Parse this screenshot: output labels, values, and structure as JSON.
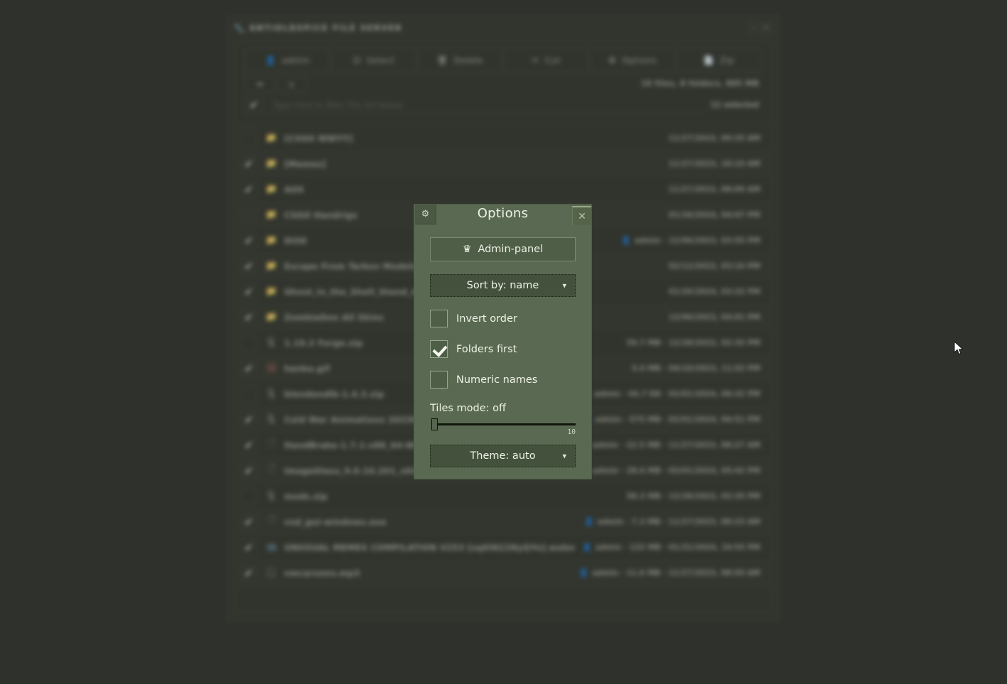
{
  "window": {
    "title": "ANTIOLDSPICE FILE SERVER",
    "wrench_icon": "wrench-icon",
    "minimize_label": "–",
    "close_label": "✕",
    "stats": "10 files, 8 folders, 885 MB",
    "selected_count": "12 selected"
  },
  "toolbar": {
    "buttons": [
      {
        "label": "admin",
        "icon": "user-icon",
        "glyph": "●"
      },
      {
        "label": "Select",
        "icon": "select-icon",
        "glyph": "☑"
      },
      {
        "label": "Delete",
        "icon": "trash-icon",
        "glyph": "■"
      },
      {
        "label": "Cut",
        "icon": "scissors-icon",
        "glyph": "✂"
      },
      {
        "label": "Options",
        "icon": "gear-icon",
        "glyph": "⚙"
      },
      {
        "label": "Zip",
        "icon": "zip-icon",
        "glyph": "▤"
      }
    ],
    "nav": [
      {
        "label": "⬅",
        "icon": "back-arrow-icon"
      },
      {
        "label": "⌂",
        "icon": "home-icon"
      }
    ]
  },
  "filter": {
    "placeholder": "Type here to filter the list below",
    "select_all_glyph": "✔"
  },
  "files": [
    {
      "name": "[CSGO WWYY]",
      "type": "folder",
      "icon": "folder-icon",
      "checked": false,
      "owner": "",
      "size": "",
      "date": "11/27/2023, 09:35 AM"
    },
    {
      "name": "[Memes]",
      "type": "folder",
      "icon": "folder-icon",
      "checked": true,
      "owner": "",
      "size": "",
      "date": "11/27/2023, 10:19 AM"
    },
    {
      "name": "AOS",
      "type": "folder",
      "icon": "folder-icon",
      "checked": true,
      "owner": "",
      "size": "",
      "date": "11/27/2023, 08:09 AM"
    },
    {
      "name": "CSGO Handrigs",
      "type": "folder",
      "icon": "folder-icon",
      "checked": false,
      "owner": "",
      "size": "",
      "date": "01/26/2024, 04:07 PM"
    },
    {
      "name": "DISK",
      "type": "folder",
      "icon": "folder-icon",
      "checked": true,
      "owner": "admin",
      "size": "",
      "date": "12/06/2023, 03:55 PM"
    },
    {
      "name": "Escape From Tarkov Models",
      "type": "folder",
      "icon": "folder-icon",
      "checked": true,
      "owner": "",
      "size": "",
      "date": "02/12/2022, 03:16 PM"
    },
    {
      "name": "Ghost_in_the_Shell_Stand_Alone",
      "type": "folder",
      "icon": "folder-icon",
      "checked": true,
      "owner": "",
      "size": "",
      "date": "01/26/2024, 03:32 PM"
    },
    {
      "name": "ZombieDen All Skins",
      "type": "folder",
      "icon": "folder-icon",
      "checked": true,
      "owner": "",
      "size": "",
      "date": "12/06/2023, 04:01 PM"
    },
    {
      "name": "1.19.2 Forge.zip",
      "type": "archive",
      "icon": "archive-icon",
      "checked": false,
      "owner": "",
      "size": "59.7 MB",
      "date": "12/28/2022, 02:35 PM"
    },
    {
      "name": "hanka.gif",
      "type": "image",
      "icon": "image-icon",
      "checked": true,
      "owner": "",
      "size": "5.9 MB",
      "date": "04/16/2023, 11:52 PM"
    },
    {
      "name": "blendendlb-1.4.3.zip",
      "type": "archive",
      "icon": "archive-icon",
      "checked": false,
      "owner": "admin",
      "size": "44.7 KB",
      "date": "02/01/2024, 06:32 PM"
    },
    {
      "name": "Cold War Animations 2023M",
      "type": "archive",
      "icon": "archive-icon",
      "checked": true,
      "owner": "admin",
      "size": "575 MB",
      "date": "02/01/2024, 06:51 PM"
    },
    {
      "name": "HandBrake-1.7.1-x86_64-Win",
      "type": "file",
      "icon": "file-icon",
      "checked": true,
      "owner": "admin",
      "size": "22.5 MB",
      "date": "11/27/2023, 08:27 AM"
    },
    {
      "name": "ImageGlass_9.0.10.201_x64.msi",
      "type": "file",
      "icon": "file-icon",
      "checked": true,
      "owner": "admin",
      "size": "28.6 MB",
      "date": "02/01/2024, 05:42 PM"
    },
    {
      "name": "mods.zip",
      "type": "archive",
      "icon": "archive-icon",
      "checked": false,
      "owner": "",
      "size": "58.3 MB",
      "date": "12/28/2022, 02:35 PM"
    },
    {
      "name": "vsd_gui-windows.exe",
      "type": "file",
      "icon": "file-icon",
      "checked": true,
      "owner": "admin",
      "size": "7.3 MB",
      "date": "11/27/2023, 08:23 AM"
    },
    {
      "name": "UNUSUAL MEMES COMPILATION V253 [sq0iN22NyQYo].webm",
      "type": "video",
      "icon": "video-icon",
      "checked": true,
      "owner": "admin",
      "size": "122 MB",
      "date": "01/31/2024, 10:55 PM"
    },
    {
      "name": "vmcarsons.mp3",
      "type": "audio",
      "icon": "headphone-icon",
      "checked": true,
      "owner": "admin",
      "size": "11.6 MB",
      "date": "11/27/2023, 08:59 AM"
    }
  ],
  "options_dialog": {
    "title": "Options",
    "gear_icon": "gear-icon",
    "close_label": "✕",
    "admin_panel": {
      "label": "Admin-panel",
      "icon": "crown-icon"
    },
    "sort_select": {
      "label": "Sort by: name",
      "value": "name"
    },
    "checkboxes": [
      {
        "label": "Invert order",
        "checked": false
      },
      {
        "label": "Folders first",
        "checked": true
      },
      {
        "label": "Numeric names",
        "checked": false
      }
    ],
    "tiles": {
      "label": "Tiles mode: off",
      "value": 0,
      "max": 10,
      "max_label": "10"
    },
    "theme_select": {
      "label": "Theme: auto",
      "value": "auto"
    }
  },
  "colors": {
    "page_background": "#2e312c",
    "window_background": "#34372f",
    "dialog_background": "#5a6a52",
    "dialog_accent": "#4f5e47",
    "dialog_text": "#eef2e6",
    "select_background": "#44523d"
  }
}
